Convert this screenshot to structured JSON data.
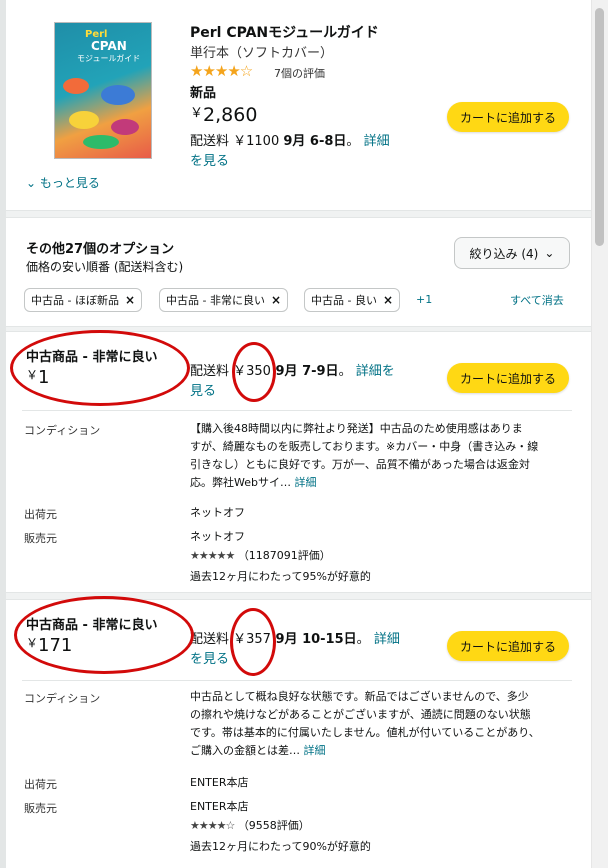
{
  "product": {
    "title": "Perl CPANモジュールガイド",
    "binding": "単行本（ソフトカバー）",
    "stars": "★★★★☆",
    "rating_count": "7個の評価",
    "condition": "新品",
    "price_yen": "￥",
    "price_value": "2,860",
    "ship_prefix": "配送料 ￥1100",
    "ship_dates": "9月 6-8日",
    "ship_suffix": "。",
    "details_link_a": "詳細",
    "details_link_b": "を見る",
    "cart_label": "カートに追加する",
    "cover_perl": "Perl",
    "cover_cpan": "CPAN",
    "cover_sub": "モジュールガイド"
  },
  "see_more": "もっと見る",
  "options": {
    "title": "その他27個のオプション",
    "sort": "価格の安い順番 (配送料含む)",
    "filter_label": "絞り込み (4)",
    "chips": [
      "中古品 - ほぼ新品",
      "中古品 - 非常に良い",
      "中古品 - 良い"
    ],
    "more_chips": "+1",
    "clear_all": "すべて消去"
  },
  "offers": [
    {
      "condition": "中古商品 - 非常に良い",
      "price_yen": "￥",
      "price_value": "1",
      "ship_prefix": "配送料 ",
      "ship_fee": "￥350",
      "ship_dates": " 9月 7-9日",
      "ship_suffix": "。",
      "details_link_a": "詳細を",
      "details_link_b": "見る",
      "cart_label": "カートに追加する",
      "condition_label": "コンディション",
      "condition_text_1": "【購入後48時間以内に弊社より発送】中古品のため使用感はありま",
      "condition_text_2": "すが、綺麗なものを販売しております。※カバー・中身（書き込み・線",
      "condition_text_3": "引きなし）ともに良好です。万が一、品質不備があった場合は返金対",
      "condition_text_4": "応。弊社Webサイ…",
      "condition_more": "詳細",
      "ships_from_label": "出荷元",
      "ships_from": "ネットオフ",
      "sold_by_label": "販売元",
      "sold_by": "ネットオフ",
      "seller_stars": "★★★★★",
      "seller_rating": "（1187091評価）",
      "seller_positive": "過去12ヶ月にわたって95%が好意的"
    },
    {
      "condition": "中古商品 - 非常に良い",
      "price_yen": "￥",
      "price_value": "171",
      "ship_prefix": "配送料 ",
      "ship_fee": "￥357",
      "ship_dates": " 9月 10-15日",
      "ship_suffix": "。",
      "details_link_a": "詳細",
      "details_link_b": "を見る",
      "cart_label": "カートに追加する",
      "condition_label": "コンディション",
      "condition_text_1": "中古品として概ね良好な状態です。新品ではございませんので、多少",
      "condition_text_2": "の擦れや焼けなどがあることがございますが、通読に問題のない状態",
      "condition_text_3": "です。帯は基本的に付属いたしません。値札が付いていることがあり、",
      "condition_text_4": "ご購入の金額とは差…",
      "condition_more": "詳細",
      "ships_from_label": "出荷元",
      "ships_from": "ENTER本店",
      "sold_by_label": "販売元",
      "sold_by": "ENTER本店",
      "seller_stars": "★★★★☆",
      "seller_rating": "（9558評価）",
      "seller_positive": "過去12ヶ月にわたって90%が好意的"
    }
  ],
  "colors": {
    "cart_button": "#ffd814",
    "link": "#007185",
    "annotation_circle": "#d20a0a",
    "star": "#f4a41c"
  }
}
